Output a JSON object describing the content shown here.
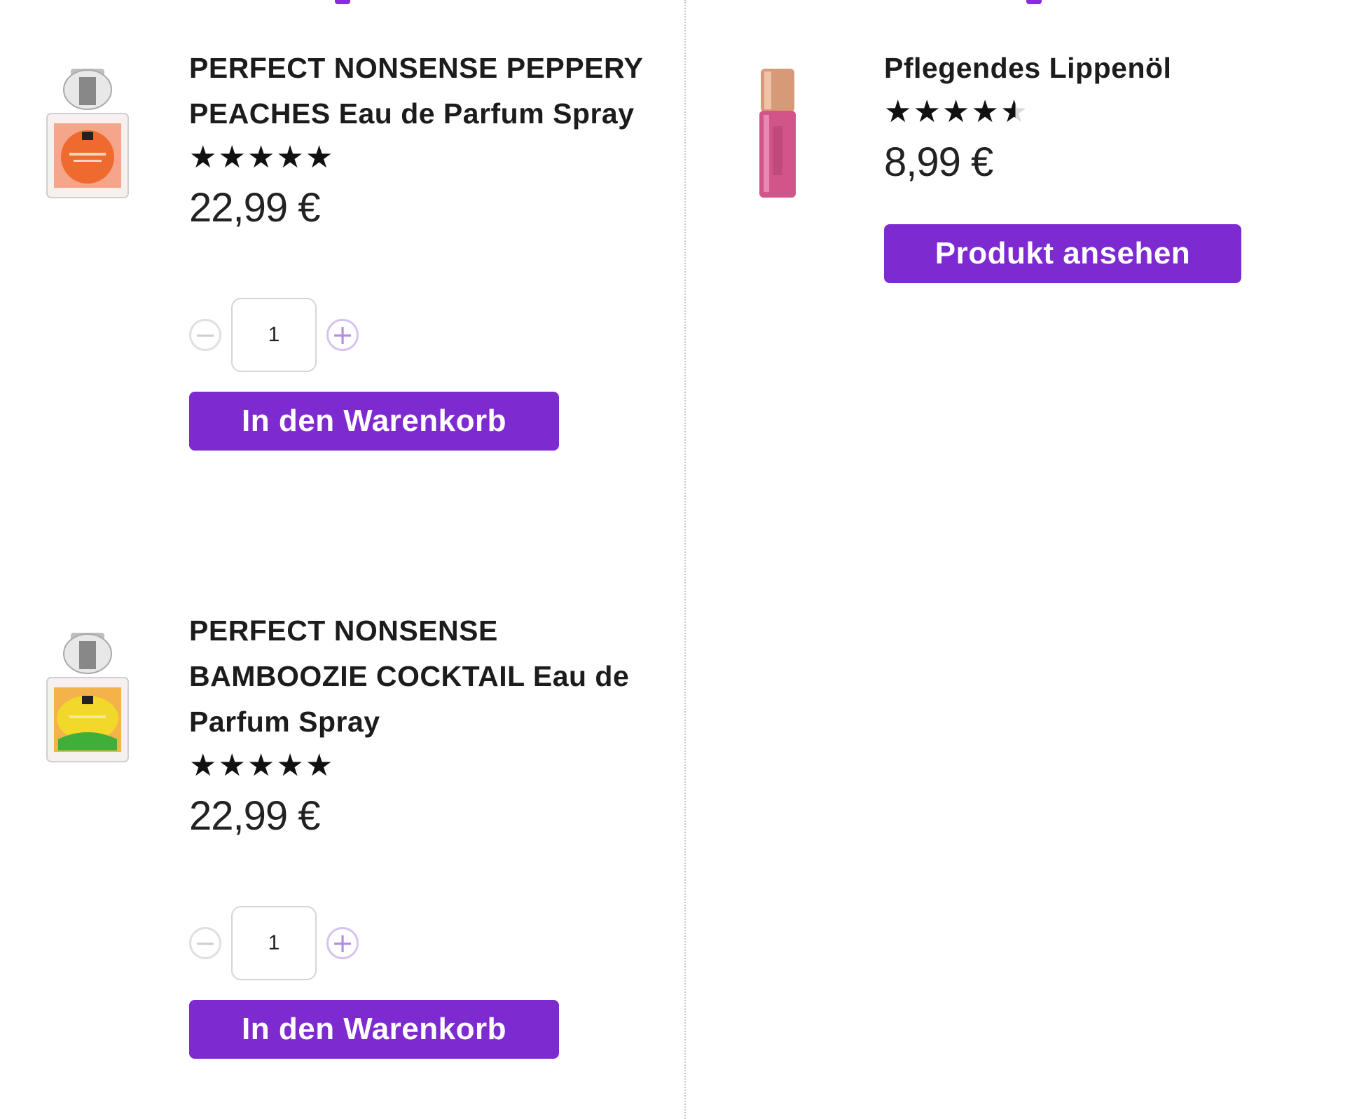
{
  "products": [
    {
      "title": "PERFECT NONSENSE PEPPERY PEACHES Eau de Parfum Spray",
      "image_icon": "perfume-bottle-orange-icon",
      "rating": 5,
      "price": "22,99 €",
      "quantity": "1",
      "button_label": "In den Warenkorb"
    },
    {
      "title": "PERFECT NONSENSE BAMBOOZIE COCKTAIL Eau de Parfum Spray",
      "image_icon": "perfume-bottle-yellow-icon",
      "rating": 5,
      "price": "22,99 €",
      "quantity": "1",
      "button_label": "In den Warenkorb"
    },
    {
      "title": "Pflegendes Lippenöl",
      "image_icon": "lip-oil-tube-icon",
      "rating": 4.5,
      "price": "8,99 €",
      "button_label": "Produkt ansehen"
    }
  ],
  "icons": {
    "minus": "−",
    "plus": "+",
    "star": "★"
  },
  "colors": {
    "accent": "#7e2ad1",
    "divider": "#c8c8c8"
  }
}
